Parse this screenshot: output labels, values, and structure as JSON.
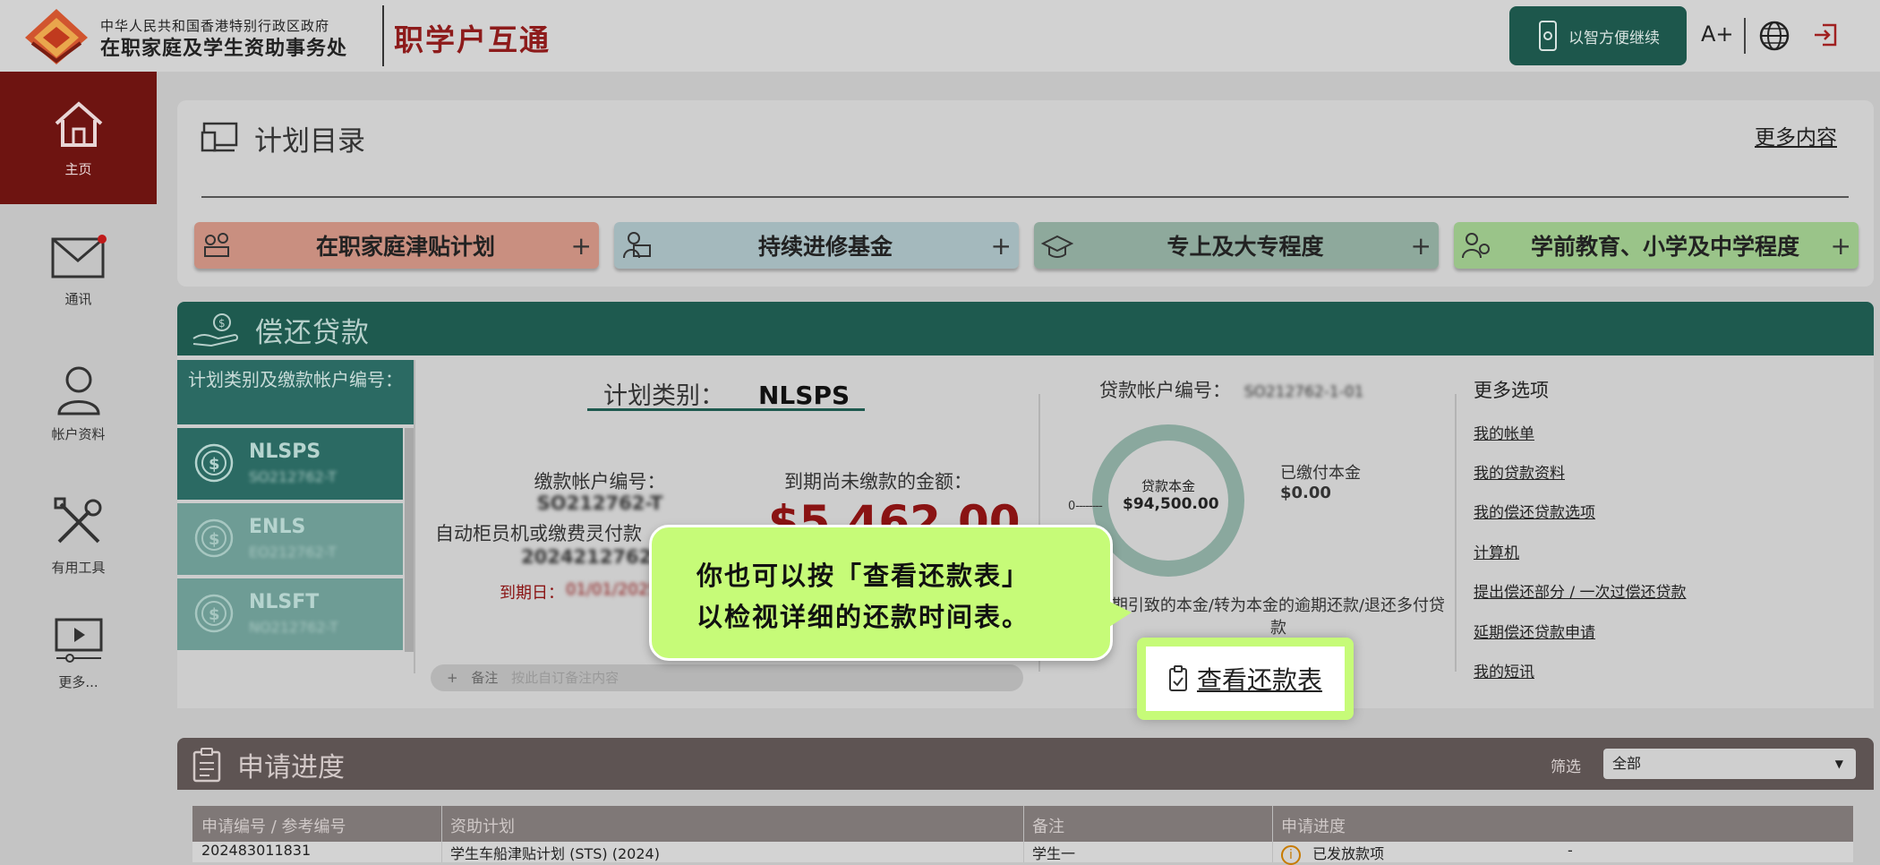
{
  "header": {
    "gov_line1": "中华人民共和国香港特别行政区政府",
    "gov_line2": "在职家庭及学生资助事务处",
    "app_title": "职学户互通",
    "mobile_continue": "以智方便继续",
    "font_size": "A+"
  },
  "sidebar": {
    "items": [
      {
        "label": "主页",
        "icon": "home-icon"
      },
      {
        "label": "通讯",
        "icon": "mail-icon"
      },
      {
        "label": "帐户资料",
        "icon": "user-icon"
      },
      {
        "label": "有用工具",
        "icon": "tools-icon"
      },
      {
        "label": "更多...",
        "icon": "video-icon"
      }
    ]
  },
  "plan_catalog": {
    "title": "计划目录",
    "more": "更多内容",
    "programs": [
      {
        "label": "在职家庭津贴计划",
        "color": "#c98f80"
      },
      {
        "label": "持续进修基金",
        "color": "#a4b9bd"
      },
      {
        "label": "专上及大专程度",
        "color": "#8ea99c"
      },
      {
        "label": "学前教育、小学及中学程度",
        "color": "#9ac489"
      }
    ]
  },
  "repay": {
    "title": "偿还贷款",
    "account_header": "计划类别及缴款帐户编号：",
    "accounts": [
      {
        "name": "NLSPS",
        "number": "SO212762-T"
      },
      {
        "name": "ENLS",
        "number": "EO212762-T"
      },
      {
        "name": "NLSFT",
        "number": "NO212762-T"
      }
    ],
    "plan_type_label": "计划类别：",
    "plan_type_value": "NLSPS",
    "payment_acct_label": "缴款帐户编号：",
    "payment_acct_value": "SO212762-T",
    "atm_label": "自动柜员机或缴费灵付款",
    "atm_value": "20242127621S",
    "due_date_label": "到期日：",
    "due_date_value": "01/01/2025",
    "outstanding_label": "到期尚未缴款的金额：",
    "outstanding_value": "$5,462.00",
    "note_label": "备注",
    "note_placeholder": "按此自订备注内容",
    "loan_acct_label": "贷款帐户编号：",
    "loan_acct_value": "SO212762-1-01",
    "principal_label": "贷款本金",
    "principal_value": "$94,500.00",
    "paid_label": "已缴付本金",
    "paid_value": "$0.00",
    "zero_tick": "0",
    "paid_fraction": 0,
    "note_text": "期引致的本金/转为本金的逾期还款/退还多付贷款",
    "more_options_title": "更多选项",
    "options": [
      "我的帐单",
      "我的贷款资料",
      "我的偿还贷款选项",
      "计算机",
      "提出偿还部分 / 一次过偿还贷款",
      "延期偿还贷款申请",
      "我的短讯"
    ]
  },
  "tooltip": {
    "line1": "你也可以按「查看还款表」",
    "line2": "以检视详细的还款时间表。",
    "schedule_button": "查看还款表"
  },
  "progress": {
    "title": "申请进度",
    "filter_label": "筛选",
    "filter_value": "全部",
    "columns": [
      "申请编号 / 参考编号",
      "资助计划",
      "备注",
      "申请进度"
    ],
    "rows": [
      {
        "ref": "202483011831",
        "plan": "学生车船津贴计划 (STS) (2024)",
        "note": "学生一",
        "status": "已发放款项",
        "extra": "-"
      }
    ]
  },
  "colors": {
    "brand_red": "#8d1b1b",
    "repay_green": "#1e5a4f",
    "highlight": "#c6fb78"
  }
}
